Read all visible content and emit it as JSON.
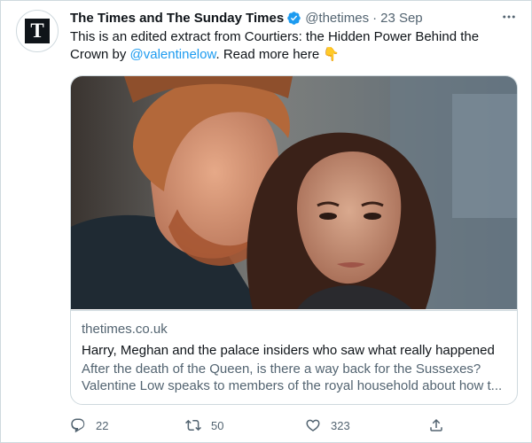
{
  "account": {
    "avatar_letter": "T",
    "name": "The Times and The Sunday Times",
    "handle": "@thetimes",
    "separator": "·",
    "time": "23 Sep"
  },
  "tweet": {
    "text_before": "This is an edited extract from Courtiers: the Hidden Power Behind the Crown by ",
    "mention": "@valentinelow",
    "text_after": ". Read more here ",
    "emoji": "👇"
  },
  "card": {
    "domain": "thetimes.co.uk",
    "title": "Harry, Meghan and the palace insiders who saw what really happened",
    "description": "After the death of the Queen, is there a way back for the Sussexes? Valentine Low speaks to members of the royal household about how t..."
  },
  "actions": {
    "replies": "22",
    "retweets": "50",
    "likes": "323"
  },
  "colors": {
    "accent": "#1d9bf0",
    "text": "#0f1419",
    "secondary": "#536471",
    "border": "#cfd9de"
  },
  "icons": [
    "more-icon",
    "verified-badge-icon",
    "reply-icon",
    "retweet-icon",
    "like-icon",
    "share-icon"
  ]
}
